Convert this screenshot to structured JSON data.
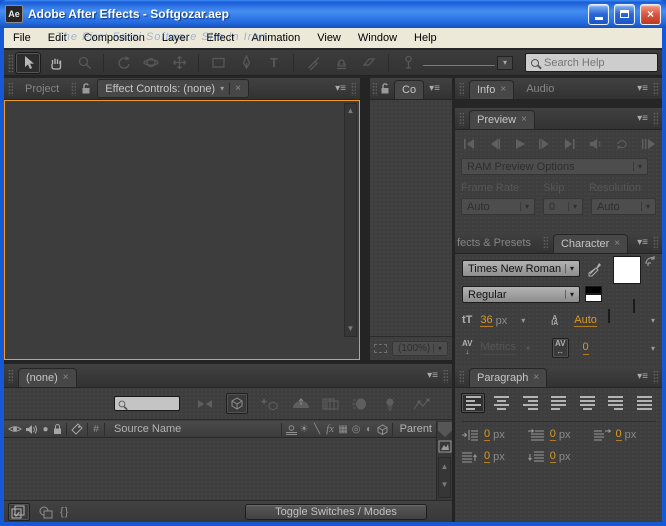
{
  "window": {
    "title": "Adobe After Effects - Softgozar.aep",
    "icon_text": "Ae",
    "watermark": "The First Farsi Software Site In Iran"
  },
  "menu": {
    "items": [
      "File",
      "Edit",
      "Composition",
      "Layer",
      "Effect",
      "Animation",
      "View",
      "Window",
      "Help"
    ]
  },
  "toolbar": {
    "search_placeholder": "Search Help"
  },
  "left": {
    "project_tab": "Project",
    "effect_controls_tab": "Effect Controls: (none)"
  },
  "comp": {
    "tab": "Co",
    "magnification": "(100%)"
  },
  "right": {
    "info_tab": "Info",
    "audio_tab": "Audio",
    "preview": {
      "tab": "Preview",
      "ram_button": "RAM Preview Options",
      "frame_rate_label": "Frame Rate",
      "skip_label": "Skip",
      "resolution_label": "Resolution",
      "frame_rate": "Auto",
      "skip": "0",
      "resolution": "Auto"
    },
    "effects_presets_tab": "fects & Presets",
    "character": {
      "tab": "Character",
      "font_family": "Times New Roman",
      "font_style": "Regular",
      "font_size": "36",
      "leading": "Auto",
      "kerning": "Metrics",
      "tracking": "0",
      "unit": "px"
    },
    "paragraph": {
      "tab": "Paragraph",
      "indent_left": "0",
      "first_line_indent": "0",
      "indent_right": "0",
      "space_before": "0",
      "space_after": "0",
      "unit": "px"
    }
  },
  "timeline": {
    "tab": "(none)",
    "source_name": "Source Name",
    "parent": "Parent",
    "toggle_button": "Toggle Switches / Modes"
  },
  "icons": {
    "close": "×",
    "panel_menu": "▾≡",
    "dd_arrow": "▾",
    "up_arrow": "▲",
    "down_arrow": "▼",
    "solo": "●",
    "sun": "☀",
    "quality": "╲",
    "fx": "fx",
    "hash": "#",
    "film": "▦",
    "motion_blur": "◎",
    "adjustment": "◐",
    "braces": "{}",
    "type_t": "T",
    "font_size": "tT",
    "av": "AV",
    "leading_a": "A",
    "leading_ia": "IA",
    "h_arrow": "↔",
    "down_small": "↓"
  },
  "colors": {
    "accent_orange": "#f09a2e",
    "value_orange": "#d89a2a",
    "titlebar_blue": "#2268e0",
    "window_border_blue": "#1459d6",
    "close_red": "#dd5540",
    "menubar_beige": "#ece9d8",
    "panel_gray": "#3e3e3e"
  }
}
